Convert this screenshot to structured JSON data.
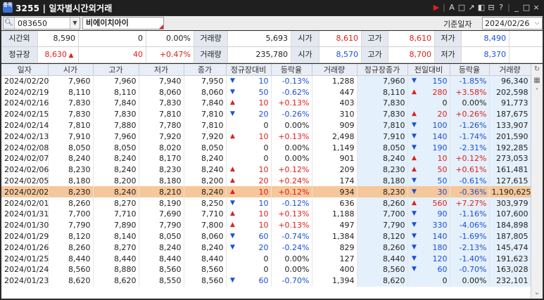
{
  "window": {
    "icon_text": "종목",
    "title": "3255 | 일자별시간외거래"
  },
  "toolbar": {
    "code": "083650",
    "name": "비에이치아이",
    "date_label": "기준일자",
    "date_value": "2024/02/26"
  },
  "summary": {
    "row1": [
      {
        "text": "시간외",
        "kind": "hdr"
      },
      {
        "text": "8,590",
        "kind": "plain"
      },
      {
        "text": "0",
        "kind": "plain"
      },
      {
        "text": "0.00%",
        "kind": "plain"
      },
      {
        "text": "거래량",
        "kind": "hdr"
      },
      {
        "text": "5,693",
        "kind": "plain"
      },
      {
        "text": "시가",
        "kind": "hdr"
      },
      {
        "text": "8,610",
        "kind": "red"
      },
      {
        "text": "고가",
        "kind": "hdr"
      },
      {
        "text": "8,610",
        "kind": "red"
      },
      {
        "text": "저가",
        "kind": "hdr"
      },
      {
        "text": "8,490",
        "kind": "blue"
      }
    ],
    "row2": [
      {
        "text": "정규장",
        "kind": "hdr"
      },
      {
        "text": "8,630",
        "kind": "red",
        "arrow": "up"
      },
      {
        "text": "40",
        "kind": "red"
      },
      {
        "text": "+0.47%",
        "kind": "red"
      },
      {
        "text": "거래량",
        "kind": "hdr"
      },
      {
        "text": "235,780",
        "kind": "plain"
      },
      {
        "text": "시가",
        "kind": "hdr"
      },
      {
        "text": "8,570",
        "kind": "blue"
      },
      {
        "text": "고가",
        "kind": "hdr"
      },
      {
        "text": "8,700",
        "kind": "red"
      },
      {
        "text": "저가",
        "kind": "hdr"
      },
      {
        "text": "8,370",
        "kind": "blue"
      }
    ]
  },
  "table": {
    "headers": [
      "일자",
      "시가",
      "고가",
      "저가",
      "종가",
      "정규장대비",
      "등락율",
      "거래량",
      "정규장종가",
      "전일대비",
      "등락율",
      "거래량"
    ],
    "rows": [
      [
        "2024/02/20",
        "7,960",
        "7,960",
        "7,940",
        "7,950",
        "down",
        "10",
        "-0.13%",
        "1,288",
        "7,960",
        "down",
        "150",
        "-1.85%",
        "96,340"
      ],
      [
        "2024/02/19",
        "8,110",
        "8,110",
        "8,060",
        "8,060",
        "down",
        "50",
        "-0.62%",
        "447",
        "8,110",
        "up",
        "280",
        "+3.58%",
        "202,598"
      ],
      [
        "2024/02/16",
        "7,830",
        "7,840",
        "7,830",
        "7,840",
        "up",
        "10",
        "+0.13%",
        "403",
        "7,830",
        "none",
        "0",
        "0.00%",
        "91,773"
      ],
      [
        "2024/02/15",
        "7,830",
        "7,830",
        "7,810",
        "7,810",
        "down",
        "20",
        "-0.26%",
        "310",
        "7,830",
        "up",
        "20",
        "+0.26%",
        "187,675"
      ],
      [
        "2024/02/14",
        "7,810",
        "7,880",
        "7,780",
        "7,810",
        "none",
        "0",
        "0.00%",
        "909",
        "7,810",
        "down",
        "100",
        "-1.26%",
        "133,907"
      ],
      [
        "2024/02/13",
        "7,910",
        "7,960",
        "7,920",
        "7,920",
        "up",
        "10",
        "+0.13%",
        "2,498",
        "7,910",
        "down",
        "140",
        "-1.74%",
        "201,590"
      ],
      [
        "2024/02/08",
        "8,050",
        "8,050",
        "8,020",
        "8,050",
        "none",
        "0",
        "0.00%",
        "1,149",
        "8,050",
        "down",
        "190",
        "-2.31%",
        "192,285"
      ],
      [
        "2024/02/07",
        "8,240",
        "8,240",
        "8,170",
        "8,240",
        "none",
        "0",
        "0.00%",
        "901",
        "8,240",
        "up",
        "10",
        "+0.12%",
        "273,053"
      ],
      [
        "2024/02/06",
        "8,230",
        "8,240",
        "8,230",
        "8,240",
        "up",
        "10",
        "+0.12%",
        "209",
        "8,230",
        "up",
        "50",
        "+0.61%",
        "161,481"
      ],
      [
        "2024/02/05",
        "8,180",
        "8,200",
        "8,180",
        "8,200",
        "up",
        "20",
        "+0.24%",
        "174",
        "8,180",
        "down",
        "50",
        "-0.61%",
        "127,615"
      ],
      [
        "2024/02/02",
        "8,230",
        "8,240",
        "8,210",
        "8,240",
        "up",
        "10",
        "+0.12%",
        "934",
        "8,230",
        "down",
        "30",
        "-0.36%",
        "1,190,625"
      ],
      [
        "2024/02/01",
        "8,260",
        "8,270",
        "8,190",
        "8,250",
        "down",
        "10",
        "-0.12%",
        "636",
        "8,260",
        "up",
        "560",
        "+7.27%",
        "303,979"
      ],
      [
        "2024/01/31",
        "7,700",
        "7,710",
        "7,690",
        "7,710",
        "up",
        "10",
        "+0.13%",
        "1,188",
        "7,700",
        "down",
        "90",
        "-1.16%",
        "107,600"
      ],
      [
        "2024/01/30",
        "7,790",
        "7,890",
        "7,790",
        "7,800",
        "up",
        "10",
        "+0.13%",
        "497",
        "7,790",
        "down",
        "330",
        "-4.06%",
        "184,898"
      ],
      [
        "2024/01/29",
        "8,120",
        "8,140",
        "8,050",
        "8,060",
        "down",
        "60",
        "-0.74%",
        "1,384",
        "8,120",
        "down",
        "140",
        "-1.69%",
        "187,805"
      ],
      [
        "2024/01/26",
        "8,260",
        "8,270",
        "8,240",
        "8,240",
        "down",
        "20",
        "-0.24%",
        "829",
        "8,260",
        "down",
        "180",
        "-2.13%",
        "145,474"
      ],
      [
        "2024/01/25",
        "8,440",
        "8,440",
        "8,440",
        "8,440",
        "none",
        "0",
        "0.00%",
        "127",
        "8,440",
        "down",
        "120",
        "-1.40%",
        "191,623"
      ],
      [
        "2024/01/24",
        "8,560",
        "8,880",
        "8,560",
        "8,560",
        "none",
        "0",
        "0.00%",
        "400",
        "8,560",
        "down",
        "60",
        "-0.70%",
        "163,028"
      ],
      [
        "2024/01/23",
        "8,620",
        "8,620",
        "8,550",
        "8,560",
        "down",
        "60",
        "-0.70%",
        "1,394",
        "8,620",
        "none",
        "0",
        "0.00%",
        "232,101"
      ]
    ],
    "selected_row": 10
  },
  "colors": {
    "up": "#e0201b",
    "down": "#1b4fd8",
    "selected": "#f6c79a",
    "highlight": "#e4f0fb"
  }
}
